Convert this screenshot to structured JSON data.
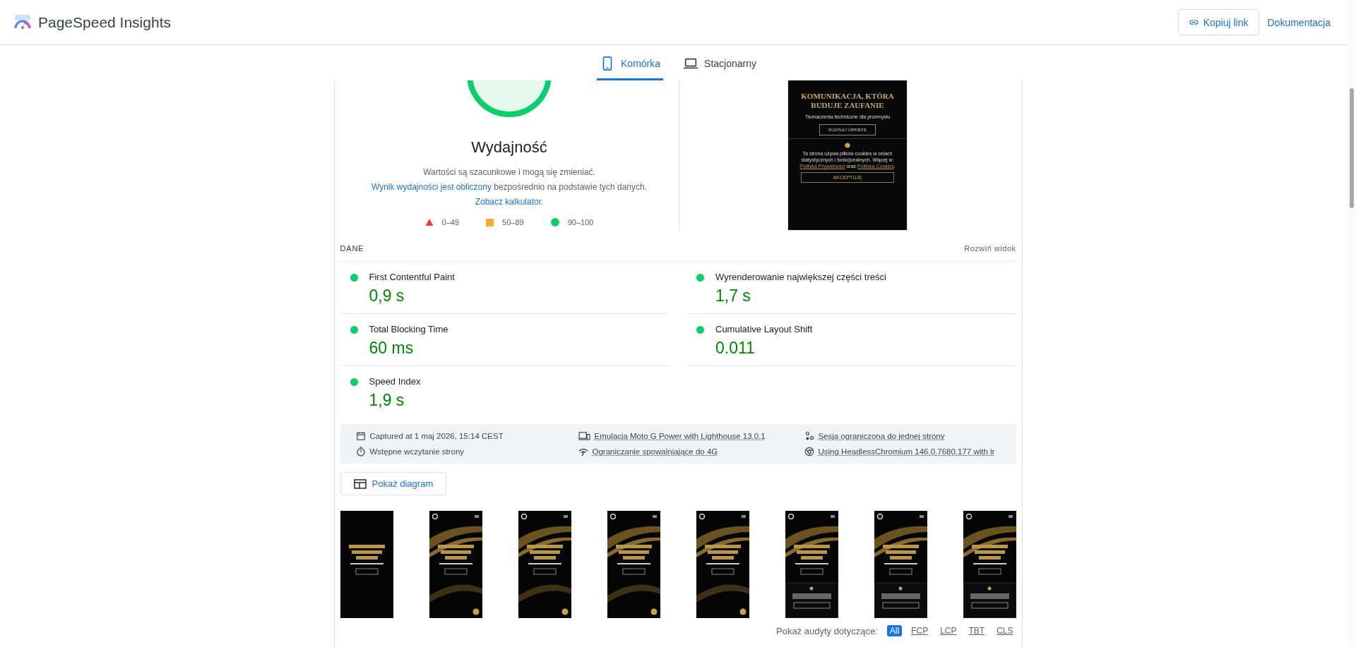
{
  "header": {
    "title": "PageSpeed Insights",
    "buttons": [
      {
        "label": "Kopiuj link",
        "kind": "outlined"
      },
      {
        "label": "Dokumentacja",
        "kind": "text"
      }
    ]
  },
  "tabs": [
    {
      "label": "Komórka",
      "selected": true
    },
    {
      "label": "Stacjonarny",
      "selected": false
    }
  ],
  "score": {
    "title": "Wydajność",
    "note": [
      {
        "kind": "text",
        "text": "Wartości są szacunkowe i mogą się zmieniać. "
      },
      {
        "kind": "link",
        "text": "Wynik wydajności jest obliczony"
      },
      {
        "kind": "text",
        "text": " bezpośrednio na podstawie tych danych. "
      },
      {
        "kind": "link",
        "text": "Zobacz kalkulator"
      },
      {
        "kind": "text",
        "text": "."
      }
    ],
    "legend": [
      {
        "kind": "triangle",
        "label": "0–49",
        "color": "#ff3333"
      },
      {
        "kind": "square",
        "label": "50–89",
        "color": "#ffaa33"
      },
      {
        "kind": "circle",
        "label": "90–100",
        "color": "#0cce6b"
      }
    ]
  },
  "screenshot": {
    "headline": "KOMUNIKACJA, KTÓRA BUDUJE ZAUFANIE",
    "subtitle": "Tłumaczenia techniczne dla przemysłu",
    "cta": "POZNAJ OFERTĘ",
    "cookie": [
      {
        "kind": "text",
        "text": "Ta strona używa plików cookies w celach statystycznych i funkcjonalnych. Więcej w: "
      },
      {
        "kind": "link",
        "text": "Polityka Prywatności"
      },
      {
        "kind": "text",
        "text": " oraz "
      },
      {
        "kind": "link",
        "text": "Polityka Cookies"
      },
      {
        "kind": "text",
        "text": "."
      }
    ],
    "accept": "AKCEPTUJĘ"
  },
  "metrics": {
    "title": "DANE",
    "expand": "Rozwiń widok",
    "items": [
      {
        "label": "First Contentful Paint",
        "value": "0,9 s"
      },
      {
        "label": "Wyrenderowanie największej części treści",
        "value": "1,7 s"
      },
      {
        "label": "Total Blocking Time",
        "value": "60 ms"
      },
      {
        "label": "Cumulative Layout Shift",
        "value": "0.011"
      },
      {
        "label": "Speed Index",
        "value": "1,9 s"
      }
    ]
  },
  "info": [
    {
      "text": "Captured at 1 maj 2026, 15:14 CEST",
      "link": false
    },
    {
      "text": "Emulacja Moto G Power with Lighthouse 13.0.1",
      "link": true
    },
    {
      "text": "Sesja ograniczona do jednej strony",
      "link": true
    },
    {
      "text": "Wstępne wczytanie strony",
      "link": false
    },
    {
      "text": "Ograniczanie spowalniające do 4G",
      "link": true
    },
    {
      "text": "Using HeadlessChromium 146.0.7680.177 with lr",
      "link": true
    }
  ],
  "diagram_button": "Pokaż diagram",
  "audits": {
    "label": "Pokaż audyty dotyczące:",
    "filters": [
      {
        "label": "All",
        "selected": true
      },
      {
        "label": "FCP",
        "selected": false
      },
      {
        "label": "LCP",
        "selected": false
      },
      {
        "label": "TBT",
        "selected": false
      },
      {
        "label": "CLS",
        "selected": false
      }
    ]
  }
}
